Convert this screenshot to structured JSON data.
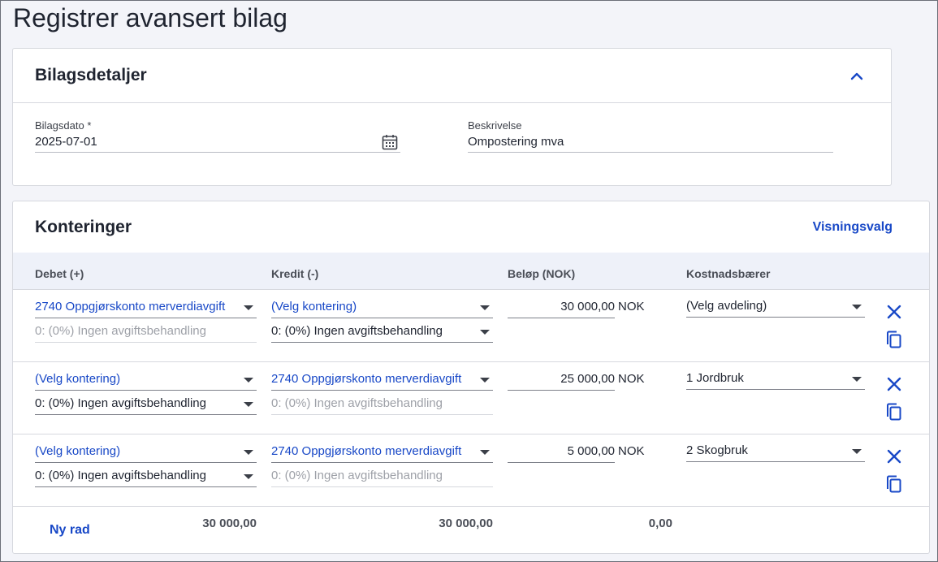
{
  "page": {
    "title": "Registrer avansert bilag"
  },
  "details": {
    "title": "Bilagsdetaljer",
    "date_label": "Bilagsdato *",
    "date_value": "2025-07-01",
    "desc_label": "Beskrivelse",
    "desc_value": "Ompostering mva"
  },
  "konteringer": {
    "title": "Konteringer",
    "view_options": "Visningsvalg",
    "columns": {
      "debet": "Debet (+)",
      "kredit": "Kredit (-)",
      "belop": "Beløp (NOK)",
      "kostnadsbaerer": "Kostnadsbærer"
    },
    "rows": [
      {
        "debet_account": "2740 Oppgjørskonto merverdiavgift",
        "debet_vat": "0: (0%) Ingen avgiftsbehandling",
        "kredit_account": "(Velg kontering)",
        "kredit_vat": "0: (0%) Ingen avgiftsbehandling",
        "amount": "30 000,00",
        "currency": "NOK",
        "cost_carrier": "(Velg avdeling)"
      },
      {
        "debet_account": "(Velg kontering)",
        "debet_vat": "0: (0%) Ingen avgiftsbehandling",
        "kredit_account": "2740 Oppgjørskonto merverdiavgift",
        "kredit_vat": "0: (0%) Ingen avgiftsbehandling",
        "amount": "25 000,00",
        "currency": "NOK",
        "cost_carrier": "1 Jordbruk"
      },
      {
        "debet_account": "(Velg kontering)",
        "debet_vat": "0: (0%) Ingen avgiftsbehandling",
        "kredit_account": "2740 Oppgjørskonto merverdiavgift",
        "kredit_vat": "0: (0%) Ingen avgiftsbehandling",
        "amount": "5 000,00",
        "currency": "NOK",
        "cost_carrier": "2 Skogbruk"
      }
    ],
    "footer": {
      "new_row": "Ny rad",
      "debet_sum": "30 000,00",
      "kredit_sum": "30 000,00",
      "difference": "0,00"
    }
  },
  "colors": {
    "accent": "#1848c7",
    "muted": "#9ea1a8",
    "background": "#f3f4f9"
  }
}
